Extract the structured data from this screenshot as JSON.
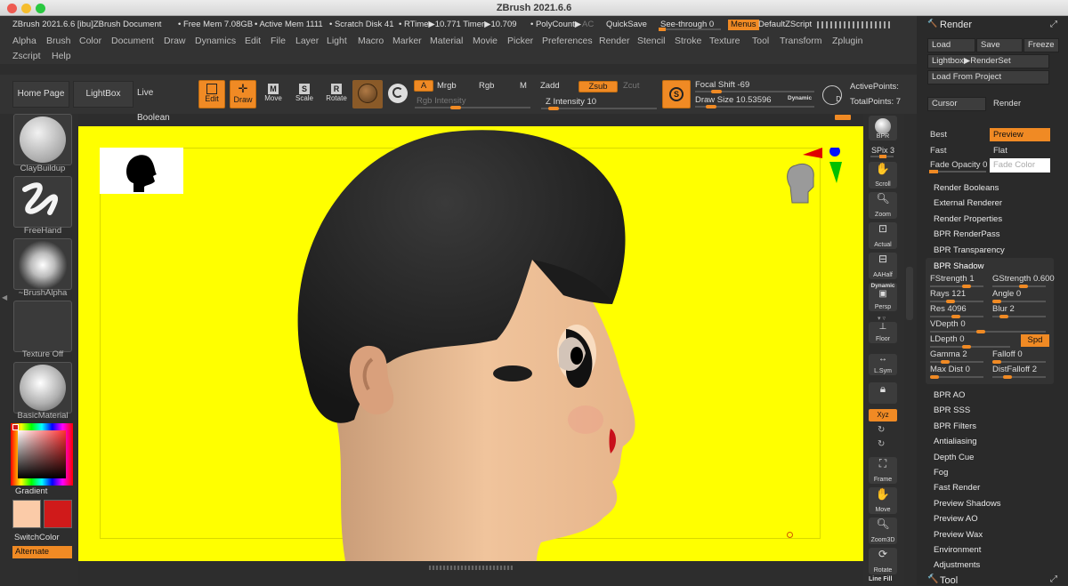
{
  "window": {
    "title": "ZBrush 2021.6.6"
  },
  "status": {
    "doc": "ZBrush 2021.6.6 [ibu]ZBrush Document",
    "free_mem": "• Free Mem 7.08GB",
    "active_mem": "• Active Mem 1111",
    "scratch": "• Scratch Disk 41",
    "rtime": "• RTime▶10.771 Timer▶10.709",
    "polycount": "• PolyCount▶",
    "ac": "AC",
    "quicksave": "QuickSave",
    "seethrough": "See-through  0",
    "menus": "Menus",
    "defaultzscript": "DefaultZScript"
  },
  "menus": [
    "Alpha",
    "Brush",
    "Color",
    "Document",
    "Draw",
    "Dynamics",
    "Edit",
    "File",
    "Layer",
    "Light",
    "Macro",
    "Marker",
    "Material",
    "Movie",
    "Picker",
    "Preferences",
    "Render",
    "Stencil",
    "Stroke",
    "Texture",
    "Tool",
    "Transform",
    "Zplugin",
    "Zscript",
    "Help"
  ],
  "shelf": {
    "home": "Home Page",
    "lightbox": "LightBox",
    "liveboolean": "Live Boolean",
    "edit": "Edit",
    "draw": "Draw",
    "move": "Move",
    "scale": "Scale",
    "rotate": "Rotate",
    "a": "A",
    "mrgb": "Mrgb",
    "rgb": "Rgb",
    "m": "M",
    "rgb_intensity": "Rgb Intensity",
    "zadd": "Zadd",
    "zsub": "Zsub",
    "zcut": "Zcut",
    "z_intensity": "Z Intensity 10",
    "focal": "Focal Shift -69",
    "drawsize": "Draw Size 10.53596",
    "dynamic": "Dynamic",
    "activepoints": "ActivePoints:",
    "totalpoints": "TotalPoints: 7",
    "s": "S",
    "d": "D"
  },
  "left": {
    "clay": "ClayBuildup",
    "freehand": "FreeHand",
    "alpha": "~BrushAlpha",
    "texture": "Texture Off",
    "material": "BasicMaterial",
    "gradient": "Gradient",
    "switch": "SwitchColor",
    "alternate": "Alternate"
  },
  "colors": {
    "main": "#fbcba8",
    "secondary": "#d01a1a",
    "canvas": "#ffff00",
    "accent": "#f08a24"
  },
  "righttray": {
    "bpr": "BPR",
    "spix": "SPix 3",
    "scroll": "Scroll",
    "zoom": "Zoom",
    "actual": "Actual",
    "aahalf": "AAHalf",
    "dynamic": "Dynamic",
    "persp": "Persp",
    "floor": "Floor",
    "lsym": "L.Sym",
    "xyz": "Xyz",
    "frame": "Frame",
    "move": "Move",
    "zoom3d": "Zoom3D",
    "rotate": "Rotate",
    "linefill": "Line Fill"
  },
  "panel": {
    "title": "Render",
    "load": "Load",
    "save": "Save",
    "freeze": "Freeze",
    "lightbox": "Lightbox▶RenderSet",
    "loadproject": "Load From Project",
    "cursor": "Cursor",
    "render": "Render",
    "best": "Best",
    "preview": "Preview",
    "fast": "Fast",
    "flat": "Flat",
    "fadeopacity": "Fade Opacity 0",
    "fadecolor": "Fade Color",
    "items_top": [
      "Render Booleans",
      "External Renderer",
      "Render Properties",
      "BPR RenderPass",
      "BPR Transparency"
    ],
    "bprshadow": "BPR Shadow",
    "fstrength": "FStrength 1",
    "gstrength": "GStrength 0.600",
    "rays": "Rays 121",
    "angle": "Angle 0",
    "res": "Res 4096",
    "blur": "Blur 2",
    "vdepth": "VDepth 0",
    "ldepth": "LDepth 0",
    "spd": "Spd",
    "gamma": "Gamma 2",
    "falloff": "Falloff 0",
    "maxdist": "Max Dist 0",
    "distfalloff": "DistFalloff 2",
    "items_bottom": [
      "BPR AO",
      "BPR SSS",
      "BPR Filters",
      "Antialiasing",
      "Depth Cue",
      "Fog",
      "Fast Render",
      "Preview Shadows",
      "Preview AO",
      "Preview Wax",
      "Environment",
      "Adjustments"
    ],
    "tool": "Tool"
  }
}
